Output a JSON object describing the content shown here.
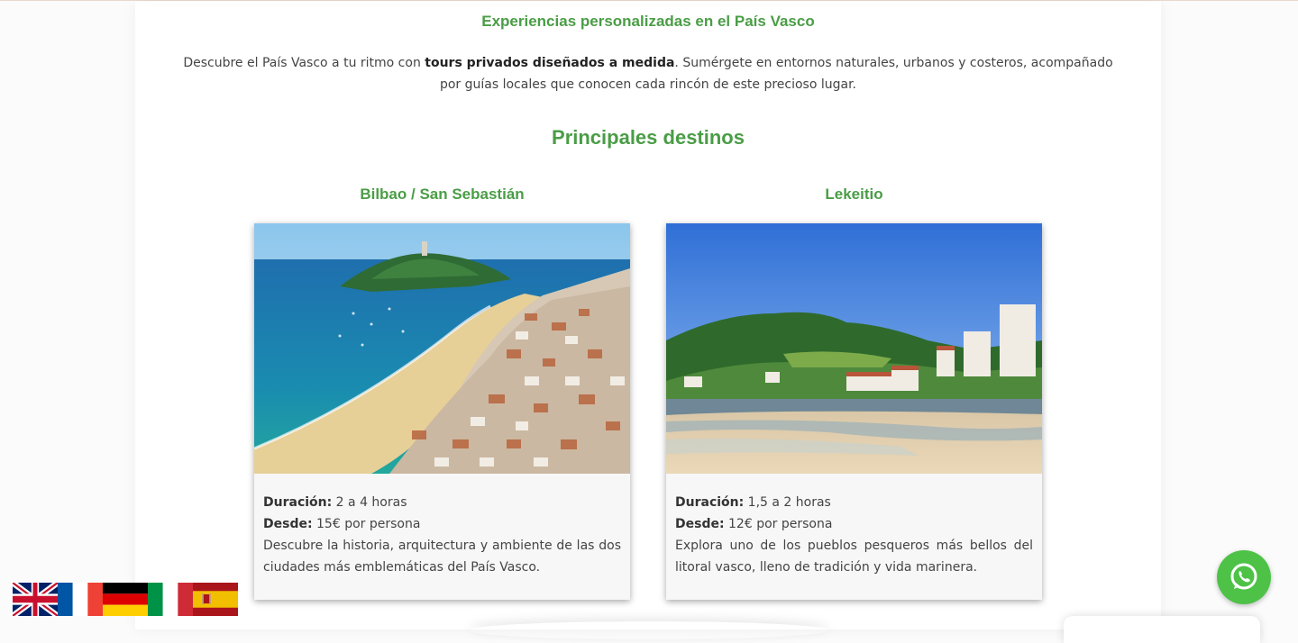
{
  "header": {
    "headline": "Experiencias personalizadas en el País Vasco",
    "intro_before": "Descubre el País Vasco a tu ritmo con ",
    "intro_bold": "tours privados diseñados a medida",
    "intro_after": ". Sumérgete en entornos naturales, urbanos y costeros, acompañado por guías locales que conocen cada rincón de este precioso lugar."
  },
  "section": {
    "title": "Principales destinos"
  },
  "destinations": [
    {
      "name": "Bilbao / San Sebastián",
      "duration_label": "Duración:",
      "duration": " 2 a 4 horas",
      "price_label": "Desde:",
      "price": " 15€ por persona",
      "description": "Descubre la historia, arquitectura y ambiente de las dos ciudades más emblemáticas del País Vasco."
    },
    {
      "name": "Lekeitio",
      "duration_label": "Duración:",
      "duration": " 1,5 a 2 horas",
      "price_label": "Desde:",
      "price": " 12€ por persona",
      "description": "Explora uno de los pueblos pesqueros más bellos del litoral vasco, lleno de tradición y vida marinera."
    }
  ],
  "language_flags": [
    "english-flag-icon",
    "french-flag-icon",
    "german-flag-icon",
    "italian-flag-icon",
    "spanish-flag-icon"
  ],
  "colors": {
    "accent_green": "#4a9d46",
    "whatsapp_green": "#4dc247",
    "body_text": "#444444"
  }
}
